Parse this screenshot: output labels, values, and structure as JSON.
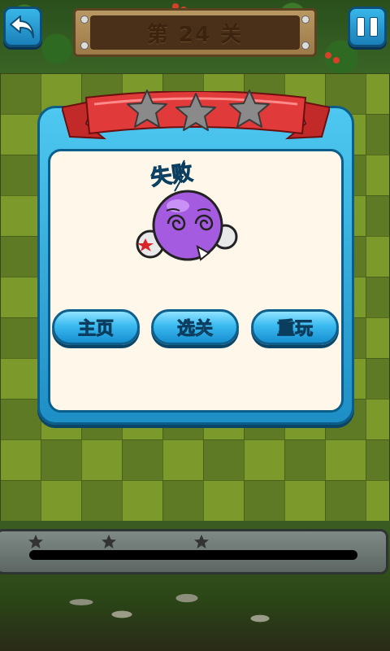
{
  "header": {
    "level_title": "第 24 关",
    "back_icon": "back-arrow-icon",
    "pause_icon": "pause-icon"
  },
  "dialog": {
    "stars_earned": 0,
    "stars_total": 3,
    "result_text": "失败",
    "buttons": {
      "home": "主页",
      "select_level": "选关",
      "replay": "重玩"
    }
  },
  "progress": {
    "fill_fraction": 0,
    "stars_earned": 0,
    "stars_total": 3
  },
  "colors": {
    "accent_blue": "#2aa8e6",
    "ribbon_red": "#e03a3a",
    "star_gray": "#8a8a8a",
    "panel_cream": "#fff8ea"
  }
}
